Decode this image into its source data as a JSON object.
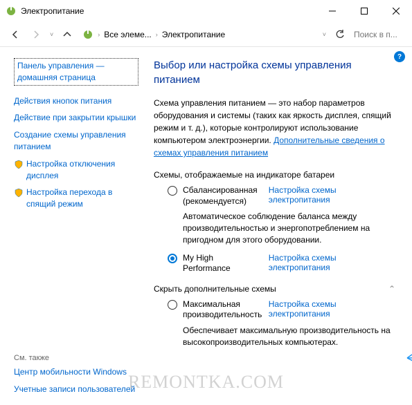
{
  "titlebar": {
    "title": "Электропитание"
  },
  "nav": {
    "crumb1": "Все элеме...",
    "crumb2": "Электропитание",
    "search_placeholder": "Поиск в п..."
  },
  "sidebar": {
    "home": "Панель управления — домашняя страница",
    "links": [
      "Действия кнопок питания",
      "Действие при закрытии крышки",
      "Создание схемы управления питанием",
      "Настройка отключения дисплея",
      "Настройка перехода в спящий режим"
    ],
    "see_also": "См. также",
    "bottom": [
      "Центр мобильности Windows",
      "Учетные записи пользователей"
    ]
  },
  "main": {
    "heading": "Выбор или настройка схемы управления питанием",
    "desc_pre": "Схема управления питанием — это набор параметров оборудования и системы (таких как яркость дисплея, спящий режим и т. д.), которые контролируют использование компьютером электроэнергии. ",
    "desc_link": "Дополнительные сведения о схемах управления питанием",
    "batt_section": "Схемы, отображаемые на индикаторе батареи",
    "plan1_name": "Сбалансированная (рекомендуется)",
    "plan_settings": "Настройка схемы электропитания",
    "plan1_desc": "Автоматическое соблюдение баланса между производительностью и энергопотреблением на пригодном для этого оборудовании.",
    "plan2_name": "My High Performance",
    "hide_label": "Скрыть дополнительные схемы",
    "plan3_name": "Максимальная производительность",
    "plan3_desc": "Обеспечивает максимальную производительность на высокопроизводительных компьютерах."
  },
  "watermark": "REMONTKA.COM",
  "help": "?"
}
